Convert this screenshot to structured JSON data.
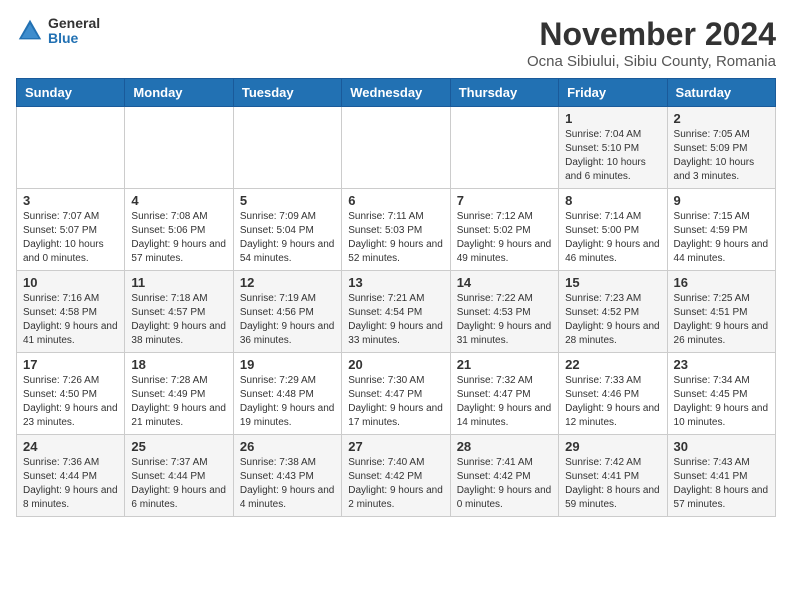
{
  "header": {
    "logo_general": "General",
    "logo_blue": "Blue",
    "month_title": "November 2024",
    "location": "Ocna Sibiului, Sibiu County, Romania"
  },
  "days_of_week": [
    "Sunday",
    "Monday",
    "Tuesday",
    "Wednesday",
    "Thursday",
    "Friday",
    "Saturday"
  ],
  "weeks": [
    [
      {
        "day": "",
        "info": ""
      },
      {
        "day": "",
        "info": ""
      },
      {
        "day": "",
        "info": ""
      },
      {
        "day": "",
        "info": ""
      },
      {
        "day": "",
        "info": ""
      },
      {
        "day": "1",
        "info": "Sunrise: 7:04 AM\nSunset: 5:10 PM\nDaylight: 10 hours and 6 minutes."
      },
      {
        "day": "2",
        "info": "Sunrise: 7:05 AM\nSunset: 5:09 PM\nDaylight: 10 hours and 3 minutes."
      }
    ],
    [
      {
        "day": "3",
        "info": "Sunrise: 7:07 AM\nSunset: 5:07 PM\nDaylight: 10 hours and 0 minutes."
      },
      {
        "day": "4",
        "info": "Sunrise: 7:08 AM\nSunset: 5:06 PM\nDaylight: 9 hours and 57 minutes."
      },
      {
        "day": "5",
        "info": "Sunrise: 7:09 AM\nSunset: 5:04 PM\nDaylight: 9 hours and 54 minutes."
      },
      {
        "day": "6",
        "info": "Sunrise: 7:11 AM\nSunset: 5:03 PM\nDaylight: 9 hours and 52 minutes."
      },
      {
        "day": "7",
        "info": "Sunrise: 7:12 AM\nSunset: 5:02 PM\nDaylight: 9 hours and 49 minutes."
      },
      {
        "day": "8",
        "info": "Sunrise: 7:14 AM\nSunset: 5:00 PM\nDaylight: 9 hours and 46 minutes."
      },
      {
        "day": "9",
        "info": "Sunrise: 7:15 AM\nSunset: 4:59 PM\nDaylight: 9 hours and 44 minutes."
      }
    ],
    [
      {
        "day": "10",
        "info": "Sunrise: 7:16 AM\nSunset: 4:58 PM\nDaylight: 9 hours and 41 minutes."
      },
      {
        "day": "11",
        "info": "Sunrise: 7:18 AM\nSunset: 4:57 PM\nDaylight: 9 hours and 38 minutes."
      },
      {
        "day": "12",
        "info": "Sunrise: 7:19 AM\nSunset: 4:56 PM\nDaylight: 9 hours and 36 minutes."
      },
      {
        "day": "13",
        "info": "Sunrise: 7:21 AM\nSunset: 4:54 PM\nDaylight: 9 hours and 33 minutes."
      },
      {
        "day": "14",
        "info": "Sunrise: 7:22 AM\nSunset: 4:53 PM\nDaylight: 9 hours and 31 minutes."
      },
      {
        "day": "15",
        "info": "Sunrise: 7:23 AM\nSunset: 4:52 PM\nDaylight: 9 hours and 28 minutes."
      },
      {
        "day": "16",
        "info": "Sunrise: 7:25 AM\nSunset: 4:51 PM\nDaylight: 9 hours and 26 minutes."
      }
    ],
    [
      {
        "day": "17",
        "info": "Sunrise: 7:26 AM\nSunset: 4:50 PM\nDaylight: 9 hours and 23 minutes."
      },
      {
        "day": "18",
        "info": "Sunrise: 7:28 AM\nSunset: 4:49 PM\nDaylight: 9 hours and 21 minutes."
      },
      {
        "day": "19",
        "info": "Sunrise: 7:29 AM\nSunset: 4:48 PM\nDaylight: 9 hours and 19 minutes."
      },
      {
        "day": "20",
        "info": "Sunrise: 7:30 AM\nSunset: 4:47 PM\nDaylight: 9 hours and 17 minutes."
      },
      {
        "day": "21",
        "info": "Sunrise: 7:32 AM\nSunset: 4:47 PM\nDaylight: 9 hours and 14 minutes."
      },
      {
        "day": "22",
        "info": "Sunrise: 7:33 AM\nSunset: 4:46 PM\nDaylight: 9 hours and 12 minutes."
      },
      {
        "day": "23",
        "info": "Sunrise: 7:34 AM\nSunset: 4:45 PM\nDaylight: 9 hours and 10 minutes."
      }
    ],
    [
      {
        "day": "24",
        "info": "Sunrise: 7:36 AM\nSunset: 4:44 PM\nDaylight: 9 hours and 8 minutes."
      },
      {
        "day": "25",
        "info": "Sunrise: 7:37 AM\nSunset: 4:44 PM\nDaylight: 9 hours and 6 minutes."
      },
      {
        "day": "26",
        "info": "Sunrise: 7:38 AM\nSunset: 4:43 PM\nDaylight: 9 hours and 4 minutes."
      },
      {
        "day": "27",
        "info": "Sunrise: 7:40 AM\nSunset: 4:42 PM\nDaylight: 9 hours and 2 minutes."
      },
      {
        "day": "28",
        "info": "Sunrise: 7:41 AM\nSunset: 4:42 PM\nDaylight: 9 hours and 0 minutes."
      },
      {
        "day": "29",
        "info": "Sunrise: 7:42 AM\nSunset: 4:41 PM\nDaylight: 8 hours and 59 minutes."
      },
      {
        "day": "30",
        "info": "Sunrise: 7:43 AM\nSunset: 4:41 PM\nDaylight: 8 hours and 57 minutes."
      }
    ]
  ]
}
